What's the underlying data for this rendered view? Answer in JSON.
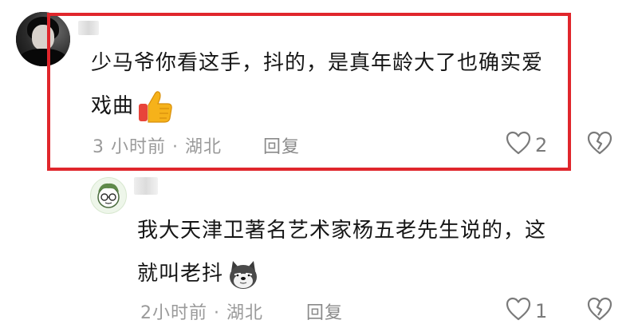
{
  "comments": [
    {
      "text": "少马爷你看这手，抖的，是真年龄大了也确实爱戏曲",
      "text_line1": "少马爷你看这手，抖的，是真年龄大了也确实爱",
      "text_line2": "戏曲",
      "emoji": "thumbs-up",
      "time": "3 小时前",
      "location": "湖北",
      "meta": "3 小时前 · 湖北",
      "reply_label": "回复",
      "likes": "2"
    },
    {
      "text": "我大天津卫著名艺术家杨五老先生说的，这就叫老抖",
      "text_line1": "我大天津卫著名艺术家杨五老先生说的，这",
      "text_line2": "就叫老抖",
      "emoji": "doge",
      "time": "2小时前",
      "location": "湖北",
      "meta": "2小时前 · 湖北",
      "reply_label": "回复",
      "likes": "1"
    }
  ],
  "colors": {
    "highlight_border": "#e0262c",
    "text": "#161616",
    "meta": "#9a9a9a"
  },
  "icons": [
    "heart-icon",
    "broken-heart-icon",
    "thumbs-up-emoji",
    "doge-emoji"
  ]
}
